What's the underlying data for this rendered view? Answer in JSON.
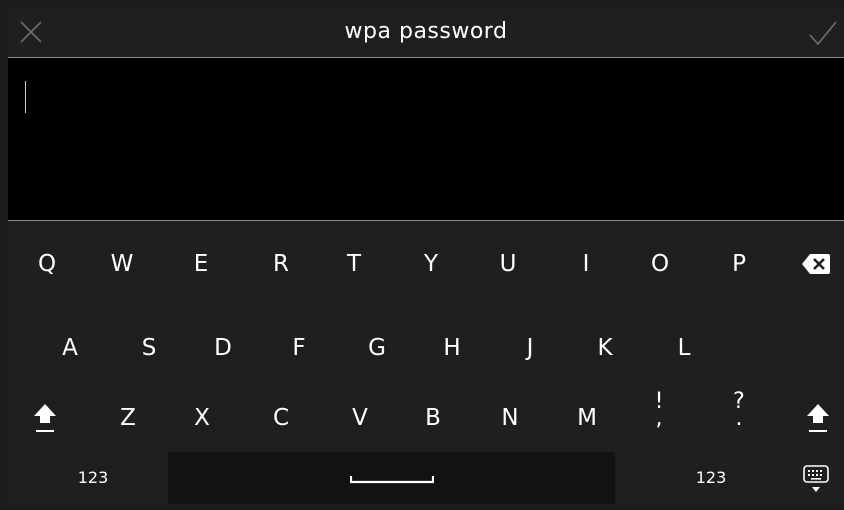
{
  "header": {
    "title": "wpa password"
  },
  "input": {
    "value": ""
  },
  "keyboard": {
    "row1": [
      "Q",
      "W",
      "E",
      "R",
      "T",
      "Y",
      "U",
      "I",
      "O",
      "P"
    ],
    "row2": [
      "A",
      "S",
      "D",
      "F",
      "G",
      "H",
      "J",
      "K",
      "L"
    ],
    "row3": [
      "Z",
      "X",
      "C",
      "V",
      "B",
      "N",
      "M"
    ],
    "punct1": {
      "top": "!",
      "bottom": ","
    },
    "punct2": {
      "top": "?",
      "bottom": "."
    },
    "mode_left": "123",
    "mode_right": "123"
  },
  "icons": {
    "cancel": "close-icon",
    "confirm": "checkmark-icon",
    "backspace": "backspace-icon",
    "shift": "shift-icon",
    "space": "space-bar-icon",
    "hide_keyboard": "keyboard-hide-icon"
  },
  "colors": {
    "background": "#1f1f20",
    "text_area": "#000000",
    "divider": "#8a8a8a",
    "icon_dim": "#6e6e6e",
    "key_text": "#ffffff"
  }
}
